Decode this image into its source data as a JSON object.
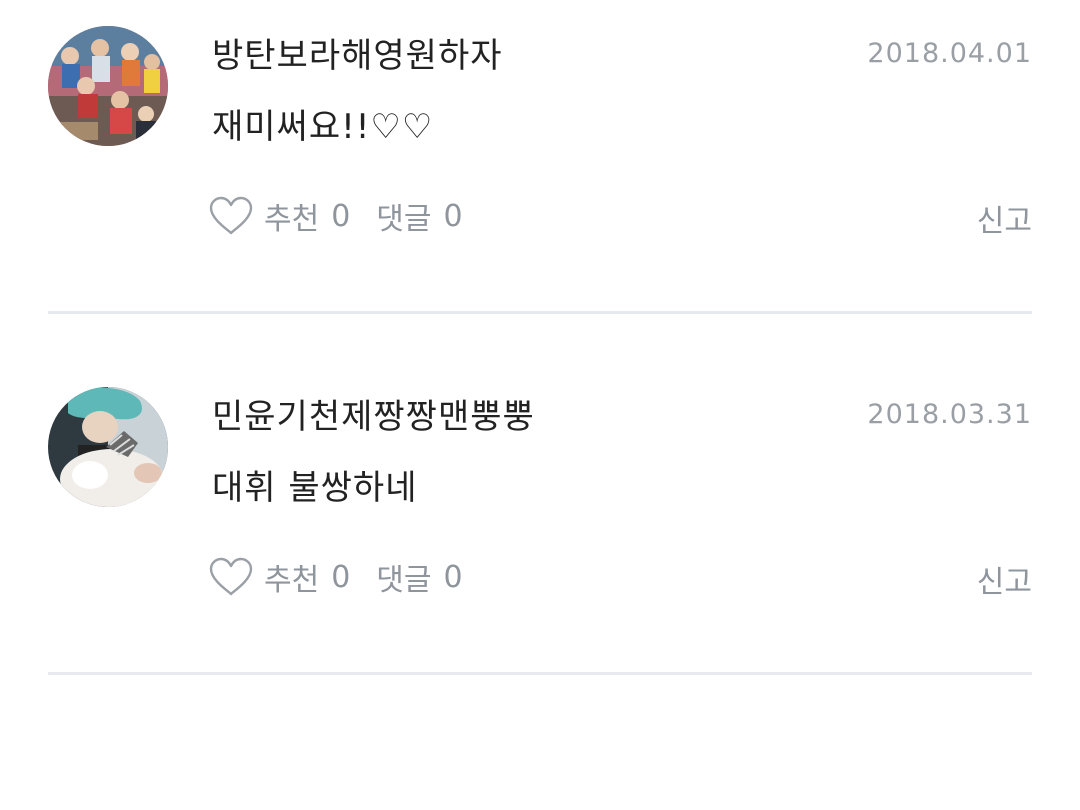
{
  "comments": [
    {
      "author": "방탄보라해영원하자",
      "date": "2018.04.01",
      "content": "재미써요!!♡♡",
      "like_label": "추천",
      "like_count": "0",
      "reply_label": "댓글",
      "reply_count": "0",
      "report_label": "신고"
    },
    {
      "author": "민윤기천제짱짱맨뿡뿡",
      "date": "2018.03.31",
      "content": "대휘 불쌍하네",
      "like_label": "추천",
      "like_count": "0",
      "reply_label": "댓글",
      "reply_count": "0",
      "report_label": "신고"
    }
  ],
  "icons": {
    "like": "heart-outline-icon"
  },
  "colors": {
    "text": "#222222",
    "muted": "#8f959c",
    "date": "#9a9fa6",
    "divider": "#e6eaee"
  }
}
